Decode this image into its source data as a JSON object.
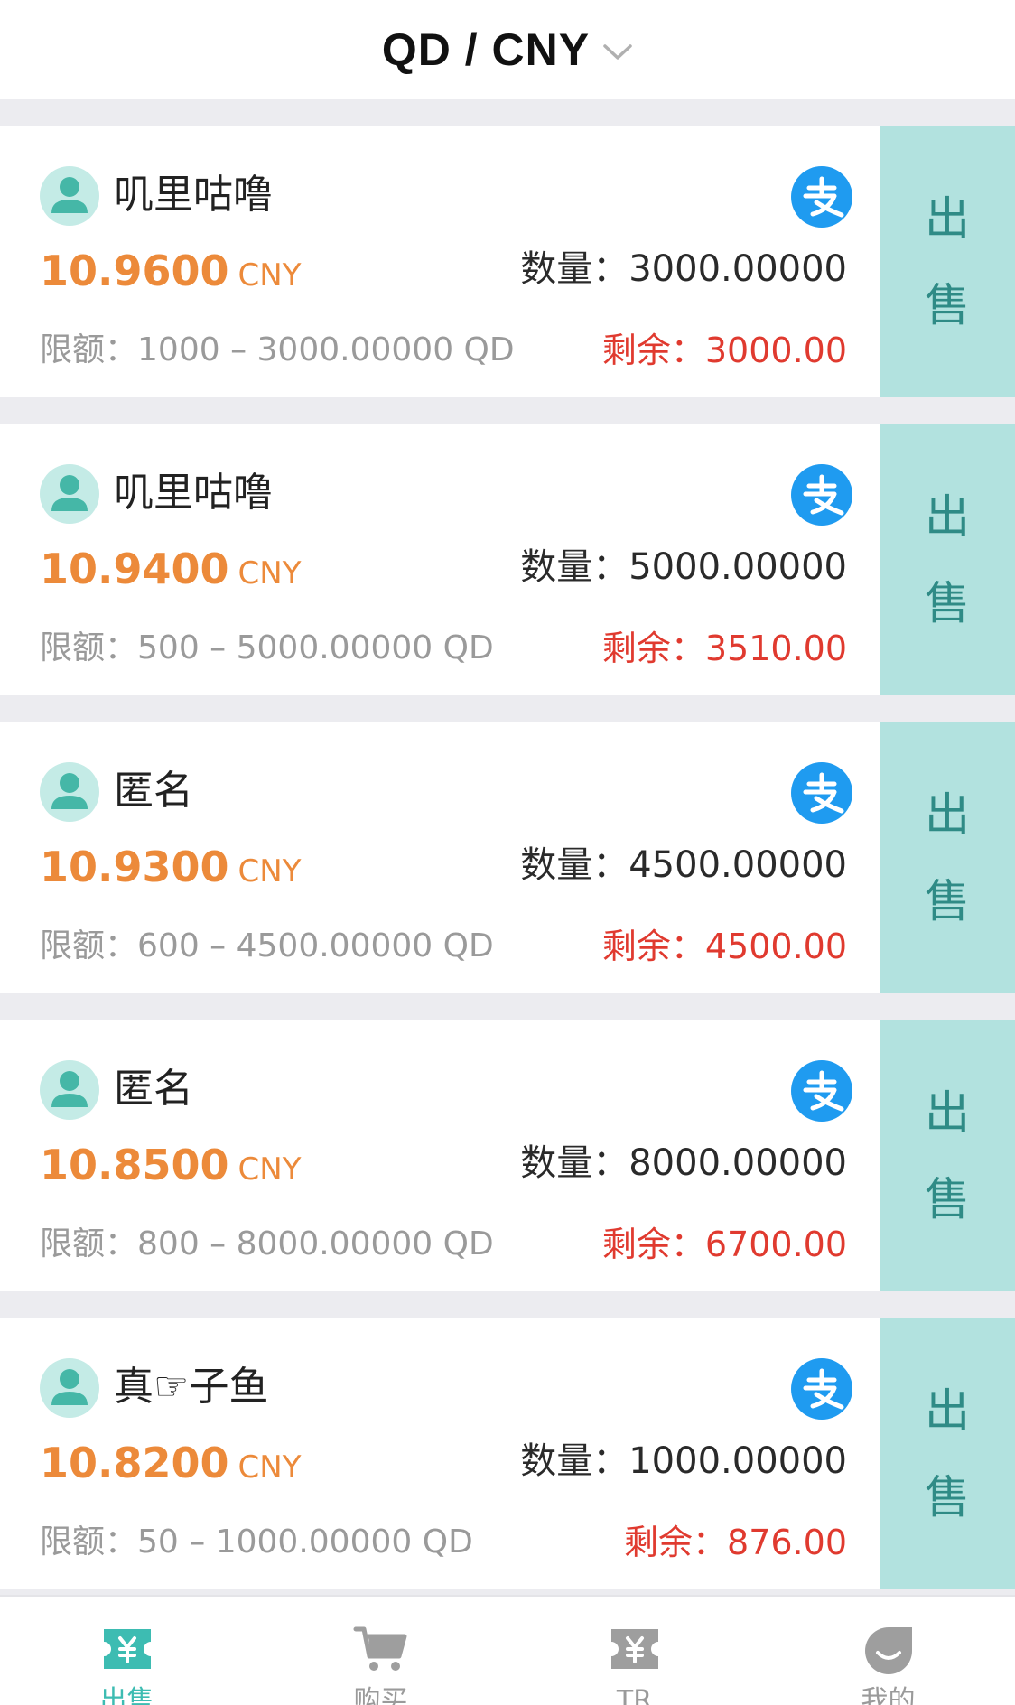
{
  "header": {
    "title": "QD / CNY",
    "dropdown_icon": "chevron-down-icon"
  },
  "colors": {
    "accent": "#3dbcb2",
    "price": "#ec8a3a",
    "remaining": "#e03a2f",
    "sell_button_bg": "#b2e2df",
    "pay_icon": "#1f9bf0"
  },
  "listings": [
    {
      "user": "叽里咕噜",
      "price": "10.9600",
      "price_unit": "CNY",
      "quantity_label": "数量：",
      "quantity": "3000.00000",
      "limit_label": "限额：",
      "limit": "1000 – 3000.00000 QD",
      "remaining_label": "剩余：",
      "remaining": "3000.00",
      "payment_icon": "alipay-icon",
      "action_char_1": "出",
      "action_char_2": "售"
    },
    {
      "user": "叽里咕噜",
      "price": "10.9400",
      "price_unit": "CNY",
      "quantity_label": "数量：",
      "quantity": "5000.00000",
      "limit_label": "限额：",
      "limit": "500 – 5000.00000 QD",
      "remaining_label": "剩余：",
      "remaining": "3510.00",
      "payment_icon": "alipay-icon",
      "action_char_1": "出",
      "action_char_2": "售"
    },
    {
      "user": "匿名",
      "price": "10.9300",
      "price_unit": "CNY",
      "quantity_label": "数量：",
      "quantity": "4500.00000",
      "limit_label": "限额：",
      "limit": "600 – 4500.00000 QD",
      "remaining_label": "剩余：",
      "remaining": "4500.00",
      "payment_icon": "alipay-icon",
      "action_char_1": "出",
      "action_char_2": "售"
    },
    {
      "user": "匿名",
      "price": "10.8500",
      "price_unit": "CNY",
      "quantity_label": "数量：",
      "quantity": "8000.00000",
      "limit_label": "限额：",
      "limit": "800 – 8000.00000 QD",
      "remaining_label": "剩余：",
      "remaining": "6700.00",
      "payment_icon": "alipay-icon",
      "action_char_1": "出",
      "action_char_2": "售"
    },
    {
      "user": "真☞子鱼",
      "price": "10.8200",
      "price_unit": "CNY",
      "quantity_label": "数量：",
      "quantity": "1000.00000",
      "limit_label": "限额：",
      "limit": "50 – 1000.00000 QD",
      "remaining_label": "剩余：",
      "remaining": "876.00",
      "payment_icon": "alipay-icon",
      "action_char_1": "出",
      "action_char_2": "售"
    }
  ],
  "tabbar": {
    "tabs": [
      {
        "label": "出售",
        "icon": "ticket-yen-icon",
        "active": true
      },
      {
        "label": "购买",
        "icon": "cart-icon",
        "active": false
      },
      {
        "label": "TR",
        "icon": "ticket-icon",
        "active": false
      },
      {
        "label": "我的",
        "icon": "profile-icon",
        "active": false
      }
    ]
  }
}
